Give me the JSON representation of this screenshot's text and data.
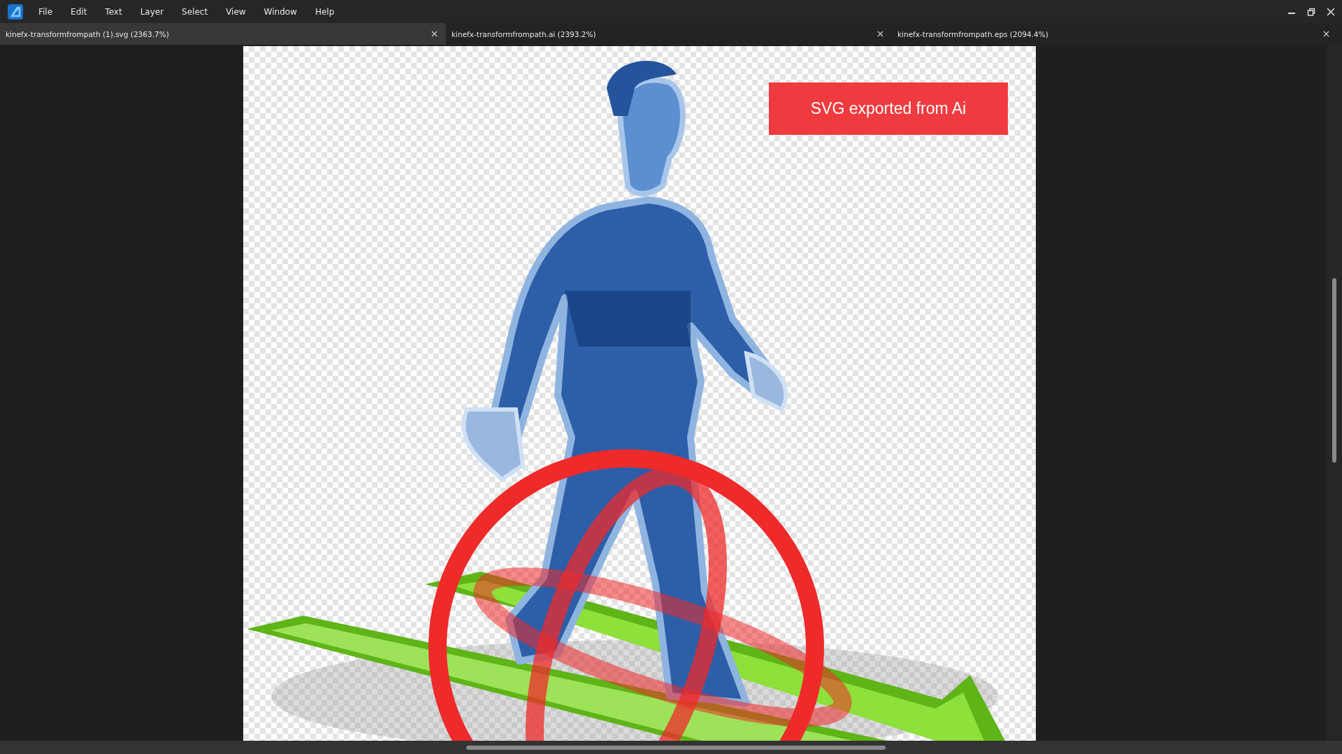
{
  "menu": [
    "File",
    "Edit",
    "Text",
    "Layer",
    "Select",
    "View",
    "Window",
    "Help"
  ],
  "tabs": [
    {
      "label": "kinefx-transformfrompath (1).svg (2363.7%)",
      "selected": true
    },
    {
      "label": "kinefx-transformfrompath.ai (2393.2%)",
      "selected": false
    },
    {
      "label": "kinefx-transformfrompath.eps (2094.4%)",
      "selected": false
    }
  ],
  "canvas": {
    "badge": "SVG exported from Ai"
  }
}
